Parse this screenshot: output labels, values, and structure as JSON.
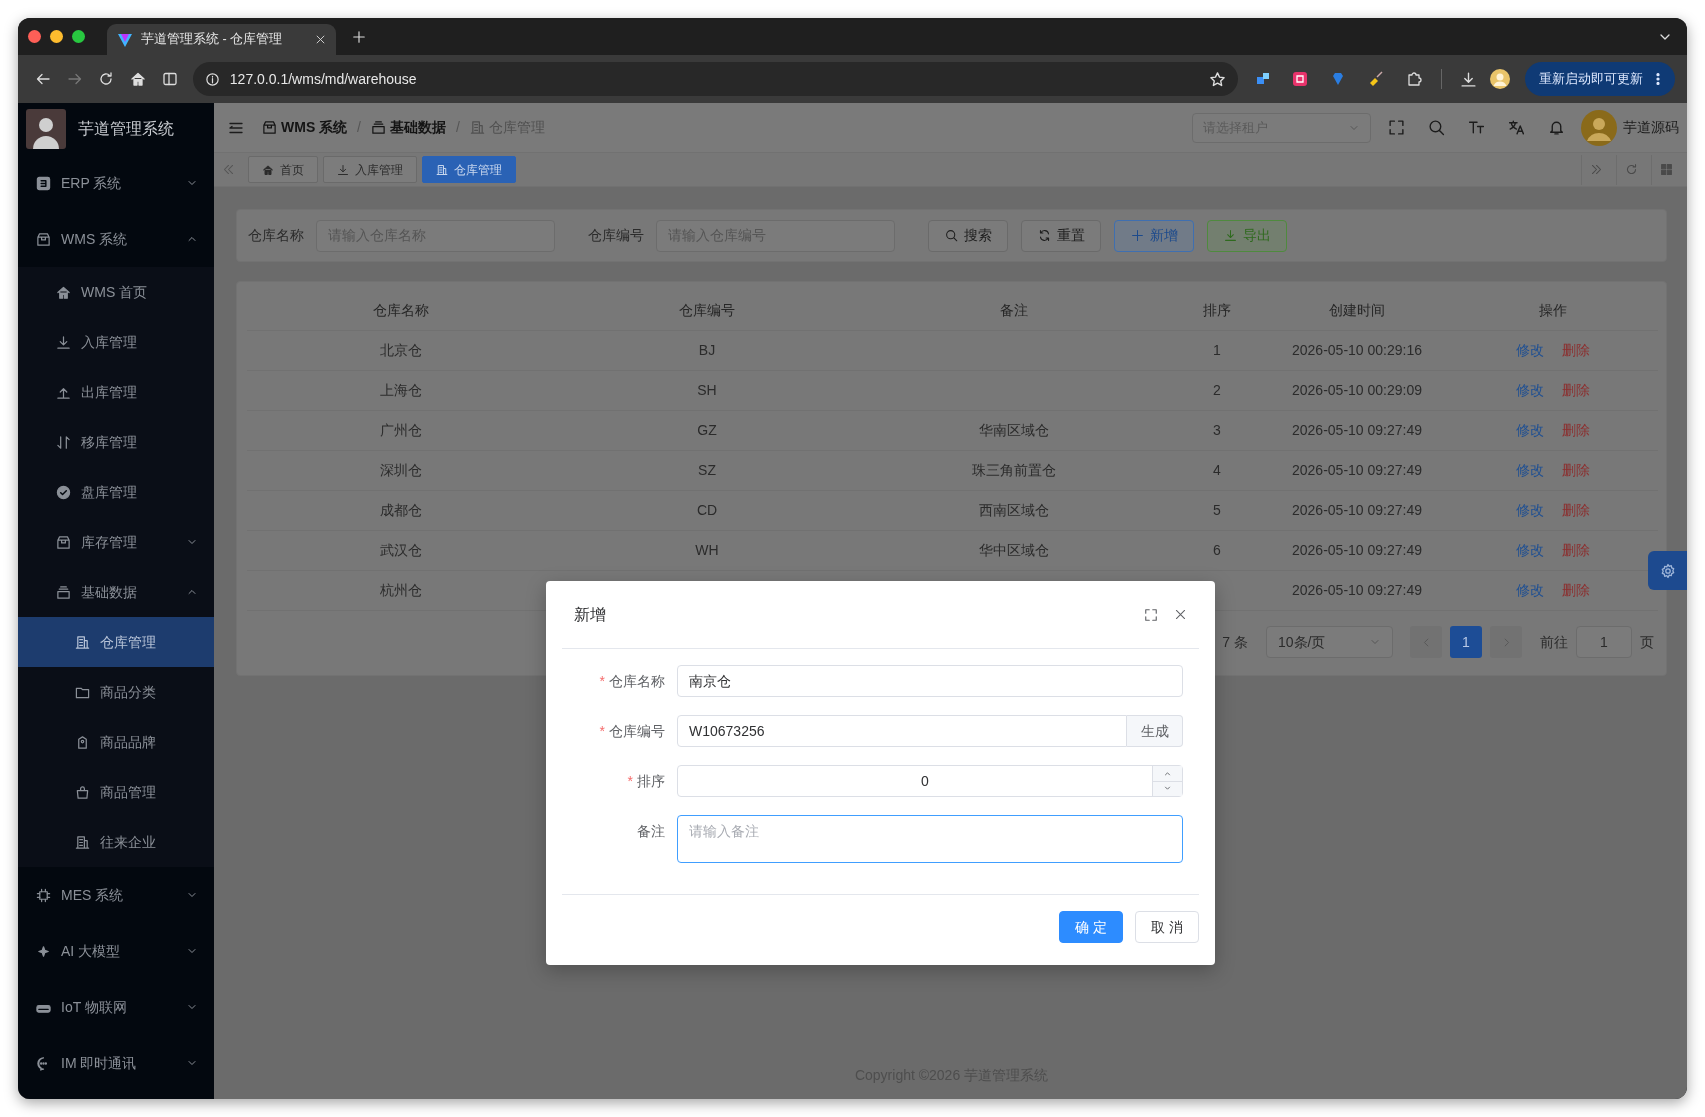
{
  "browser": {
    "tab_title": "芋道管理系统 - 仓库管理",
    "url": "127.0.0.1/wms/md/warehouse",
    "update_button": "重新启动即可更新"
  },
  "logo_title": "芋道管理系统",
  "sidebar": {
    "items": [
      {
        "label": "ERP 系统",
        "expanded": false
      },
      {
        "label": "WMS 系统",
        "expanded": true,
        "children": [
          {
            "label": "WMS 首页",
            "selected": false
          },
          {
            "label": "入库管理",
            "selected": false
          },
          {
            "label": "出库管理",
            "selected": false
          },
          {
            "label": "移库管理",
            "selected": false
          },
          {
            "label": "盘库管理",
            "selected": false
          },
          {
            "label": "库存管理",
            "expanded": false
          },
          {
            "label": "基础数据",
            "expanded": true,
            "children": [
              {
                "label": "仓库管理",
                "selected": true
              },
              {
                "label": "商品分类",
                "selected": false
              },
              {
                "label": "商品品牌",
                "selected": false
              },
              {
                "label": "商品管理",
                "selected": false
              },
              {
                "label": "往来企业",
                "selected": false
              }
            ]
          }
        ]
      },
      {
        "label": "MES 系统",
        "expanded": false
      },
      {
        "label": "AI 大模型",
        "expanded": false
      },
      {
        "label": "IoT 物联网",
        "expanded": false
      },
      {
        "label": "IM 即时通讯",
        "expanded": false
      }
    ]
  },
  "header": {
    "breadcrumbs": [
      {
        "label": "WMS 系统"
      },
      {
        "label": "基础数据"
      },
      {
        "label": "仓库管理"
      }
    ],
    "separator": "/",
    "tenant_select": {
      "placeholder": "请选择租户"
    },
    "user_name": "芋道源码"
  },
  "tabs": [
    {
      "label": "首页",
      "selected": false
    },
    {
      "label": "入库管理",
      "selected": false
    },
    {
      "label": "仓库管理",
      "selected": true
    }
  ],
  "search_form": {
    "fields": [
      {
        "label": "仓库名称",
        "placeholder": "请输入仓库名称"
      },
      {
        "label": "仓库编号",
        "placeholder": "请输入仓库编号"
      }
    ],
    "buttons": [
      {
        "label": "搜索",
        "kind": "search"
      },
      {
        "label": "重置",
        "kind": "reset"
      },
      {
        "label": "新增",
        "kind": "add"
      },
      {
        "label": "导出",
        "kind": "export"
      }
    ]
  },
  "table": {
    "columns": [
      "仓库名称",
      "仓库编号",
      "备注",
      "排序",
      "创建时间",
      "操作"
    ],
    "rows": [
      {
        "name": "北京仓",
        "code": "BJ",
        "sort": "1",
        "created_at": "2026-05-10 00:29:16",
        "actions": [
          "修改",
          "删除"
        ]
      },
      {
        "name": "上海仓",
        "code": "SH",
        "sort": "2",
        "created_at": "2026-05-10 00:29:09",
        "actions": [
          "修改",
          "删除"
        ]
      },
      {
        "name": "广州仓",
        "code": "GZ",
        "remark": "华南区域仓",
        "sort": "3",
        "created_at": "2026-05-10 09:27:49",
        "actions": [
          "修改",
          "删除"
        ]
      },
      {
        "name": "深圳仓",
        "code": "SZ",
        "remark": "珠三角前置仓",
        "sort": "4",
        "created_at": "2026-05-10 09:27:49",
        "actions": [
          "修改",
          "删除"
        ]
      },
      {
        "name": "成都仓",
        "code": "CD",
        "remark": "西南区域仓",
        "sort": "5",
        "created_at": "2026-05-10 09:27:49",
        "actions": [
          "修改",
          "删除"
        ]
      },
      {
        "name": "武汉仓",
        "code": "WH",
        "remark": "华中区域仓",
        "sort": "6",
        "created_at": "2026-05-10 09:27:49",
        "actions": [
          "修改",
          "删除"
        ]
      },
      {
        "name": "杭州仓",
        "created_at": "2026-05-10 09:27:49",
        "actions": [
          "修改",
          "删除"
        ]
      }
    ]
  },
  "pagination": {
    "total": "7 条",
    "page_size": "10条/页",
    "pages": [
      {
        "label": "1",
        "selected": true
      }
    ],
    "goto_label": "前往",
    "goto_value": "1",
    "page_suffix": "页"
  },
  "footer": "Copyright ©2026 芋道管理系统",
  "dialog": {
    "title": "新增",
    "fields": [
      {
        "label": "仓库名称",
        "required_mark": "*",
        "kind": "text",
        "value": "南京仓",
        "focused": false
      },
      {
        "label": "仓库编号",
        "required_mark": "*",
        "kind": "text_button",
        "value": "W10673256",
        "button": "生成",
        "focused": false
      },
      {
        "label": "排序",
        "required_mark": "*",
        "kind": "number",
        "value": "0",
        "focused": false
      },
      {
        "label": "备注",
        "kind": "textarea",
        "placeholder": "请输入备注",
        "focused": true
      }
    ],
    "buttons": [
      {
        "label": "确 定",
        "kind": "primary"
      },
      {
        "label": "取 消",
        "kind": "default"
      }
    ]
  }
}
